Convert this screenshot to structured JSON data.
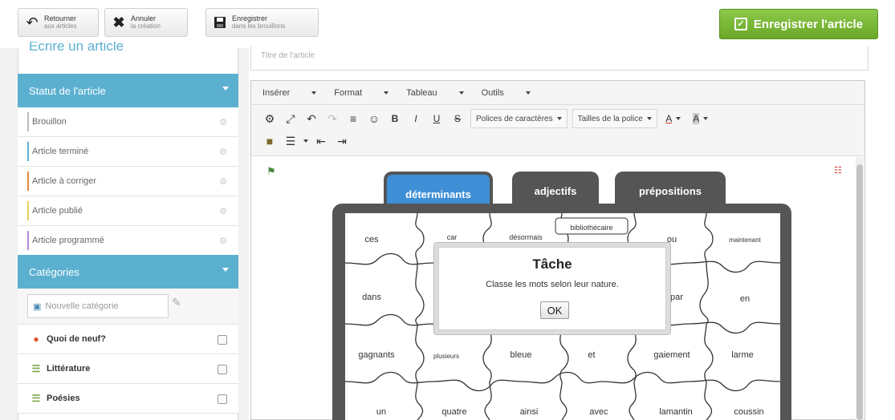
{
  "topbar": {
    "back_line1": "Retourner",
    "back_line2": "aux articles",
    "cancel_line1": "Annuler",
    "cancel_line2": "la création",
    "draft_line1": "Enregistrer",
    "draft_line2": "dans les brouillons",
    "save_article": "Enregistrer l'article",
    "accent": "#7ab83a"
  },
  "sidebar": {
    "partial_heading": "Écrire un article",
    "status_title": "Statut de l'article",
    "statuses": [
      {
        "label": "Brouillon",
        "color": "#bdbdbd"
      },
      {
        "label": "Article terminé",
        "color": "#5bb0d0"
      },
      {
        "label": "Article à corriger",
        "color": "#e38a3a"
      },
      {
        "label": "Article publié",
        "color": "#e8d05a"
      },
      {
        "label": "Article programmé",
        "color": "#b58ad6"
      }
    ],
    "categories_title": "Catégories",
    "new_category_placeholder": "Nouvelle catégorie",
    "categories": [
      {
        "label": "Quoi de neuf?",
        "icon": "news-icon"
      },
      {
        "label": "Littérature",
        "icon": "book-icon"
      },
      {
        "label": "Poésies",
        "icon": "book-icon"
      }
    ]
  },
  "editor": {
    "title_placeholder": "Titre de l'article",
    "menus": [
      "Insérer",
      "Format",
      "Tableau",
      "Outils"
    ],
    "font_dropdown": "Polices de caractères",
    "size_dropdown": "Tailles de la police",
    "text_color": "A",
    "bg_color": "A"
  },
  "game": {
    "tabs": [
      {
        "label": "déterminants",
        "color": "#3f8fd6"
      },
      {
        "label": "adjectifs",
        "color": "#555555"
      },
      {
        "label": "prépositions",
        "color": "#555555"
      }
    ],
    "rows": [
      [
        "ces",
        "car",
        "désormais",
        "bibliothécaire",
        "ou",
        "maintenant"
      ],
      [
        "dans",
        "",
        "",
        "",
        "par",
        "en"
      ],
      [
        "gagnants",
        "plusieurs",
        "bleue",
        "et",
        "gaiement",
        "larme"
      ],
      [
        "un",
        "quatre",
        "ainsi",
        "avec",
        "lamantin",
        "coussin"
      ]
    ],
    "dialog_title": "Tâche",
    "dialog_message": "Classe les mots selon leur nature.",
    "dialog_ok": "OK"
  }
}
